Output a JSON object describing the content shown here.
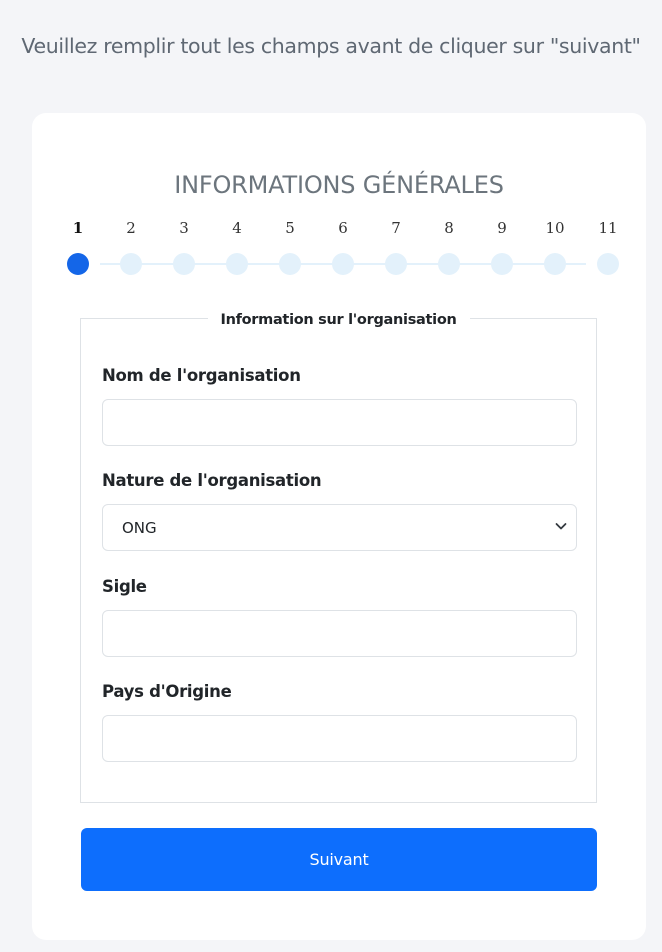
{
  "instruction": "Veuillez remplir tout les champs avant de cliquer sur \"suivant\"",
  "wizard": {
    "title": "INFORMATIONS GÉNÉRALES",
    "steps": [
      "1",
      "2",
      "3",
      "4",
      "5",
      "6",
      "7",
      "8",
      "9",
      "10",
      "11"
    ],
    "current_step": 1,
    "colors": {
      "active": "#1466e8",
      "inactive": "#e3f1fb"
    }
  },
  "form": {
    "legend": "Information sur l'organisation",
    "fields": {
      "nom": {
        "label": "Nom de l'organisation",
        "value": ""
      },
      "nature": {
        "label": "Nature de l'organisation",
        "value": "ONG",
        "icon": "chevron-down-icon"
      },
      "sigle": {
        "label": "Sigle",
        "value": ""
      },
      "pays": {
        "label": "Pays d'Origine",
        "value": ""
      }
    },
    "submit_label": "Suivant"
  },
  "colors": {
    "accent": "#0d6efd",
    "background": "#f4f5f8"
  }
}
